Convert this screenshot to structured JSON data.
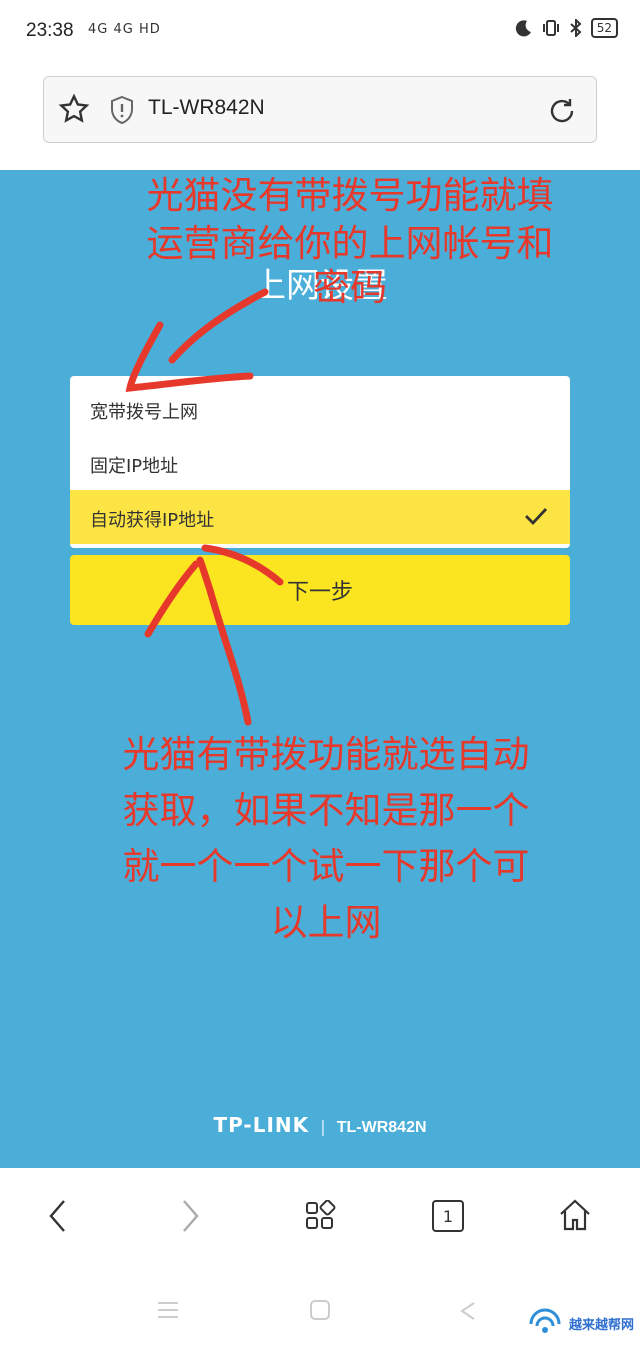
{
  "status_bar": {
    "time": "23:38",
    "network": "4G 4G HD",
    "battery": "52"
  },
  "browser": {
    "url": "TL-WR842N"
  },
  "page": {
    "title": "上网设置",
    "options": [
      {
        "label": "宽带拨号上网",
        "selected": false
      },
      {
        "label": "固定IP地址",
        "selected": false
      },
      {
        "label": "自动获得IP地址",
        "selected": true
      }
    ],
    "next_button": "下一步",
    "footer": {
      "brand": "TP-LINK",
      "model": "TL-WR842N"
    }
  },
  "annotations": {
    "top": [
      "光猫没有带拨号功能就填",
      "运营商给你的上网帐号和",
      "密码"
    ],
    "bottom": [
      "光猫有带拨功能就选自动",
      "获取，如果不知是那一个",
      "就一个一个试一下那个可",
      "以上网"
    ]
  },
  "nav": {
    "tab_count": "1"
  },
  "watermark": "越来越帮网"
}
